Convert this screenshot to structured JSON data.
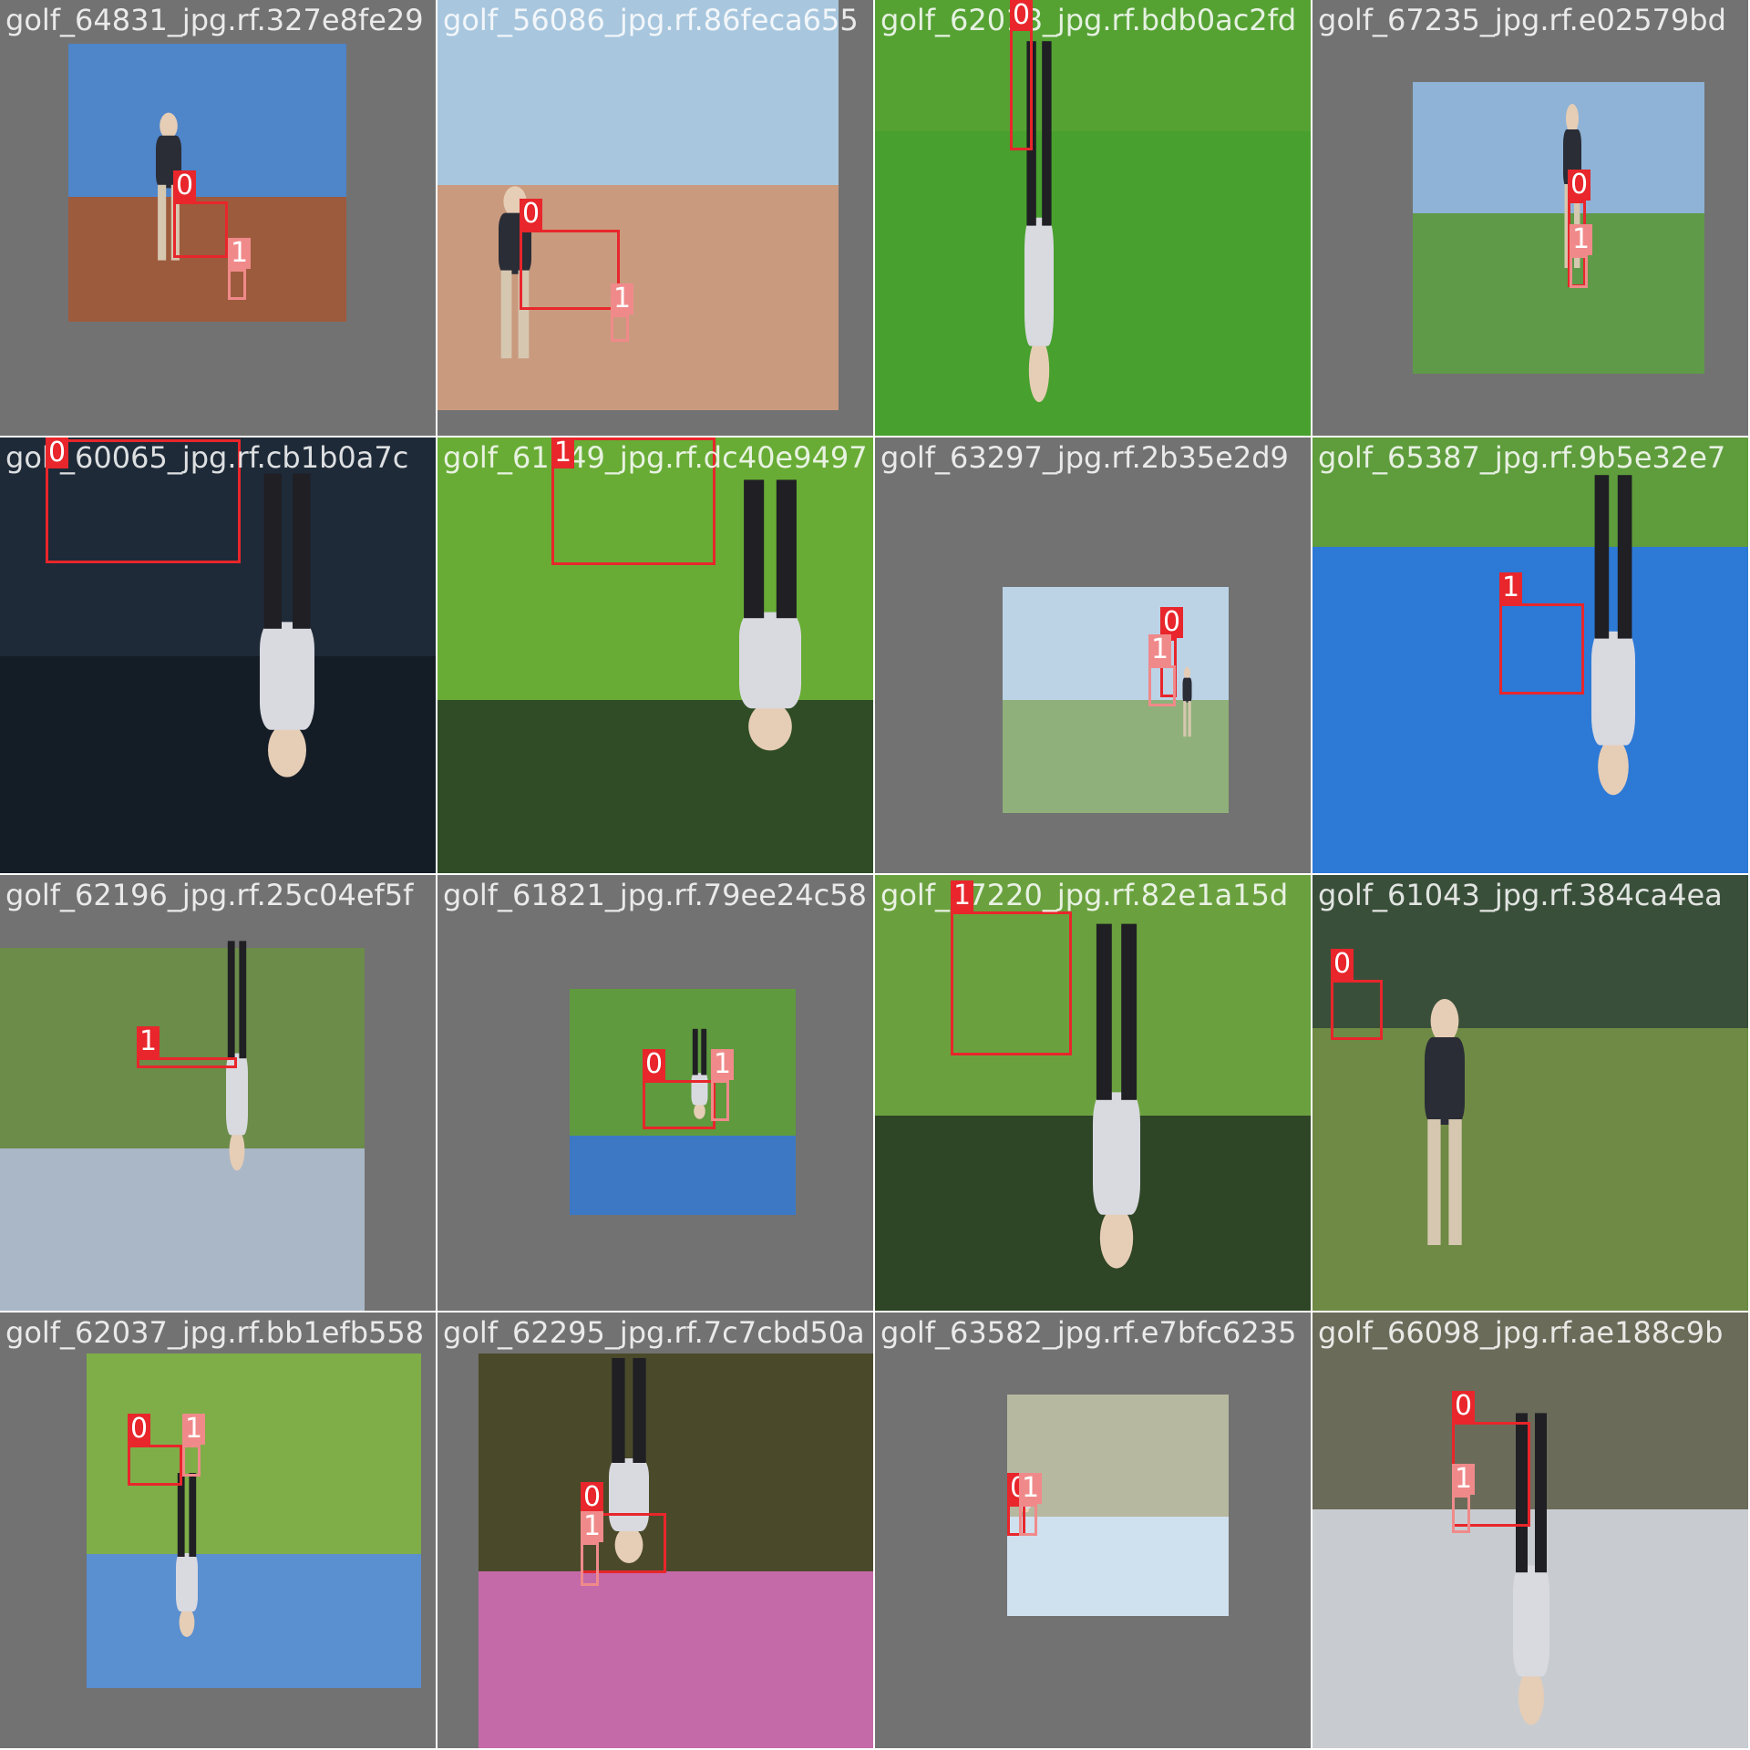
{
  "class_colors": {
    "0": "#e8262b",
    "1": "#f08a8a"
  },
  "tiles": [
    {
      "filename": "golf_64831_jpg.rf.327e8fe29",
      "sky": "#4f85c9",
      "ground": "#9d5b3e",
      "flip": false,
      "boxes": [
        {
          "label": "0",
          "cls": "0"
        },
        {
          "label": "1",
          "cls": "1"
        }
      ]
    },
    {
      "filename": "golf_56086_jpg.rf.86feca655",
      "sky": "#a8c7de",
      "ground": "#c99a7e",
      "flip": false,
      "boxes": [
        {
          "label": "0",
          "cls": "0"
        },
        {
          "label": "1",
          "cls": "1"
        }
      ]
    },
    {
      "filename": "golf_62018_jpg.rf.bdb0ac2fd",
      "sky": "#55a233",
      "ground": "#48a02e",
      "flip": true,
      "boxes": [
        {
          "label": "0",
          "cls": "0"
        }
      ]
    },
    {
      "filename": "golf_67235_jpg.rf.e02579bd",
      "sky": "#8eb3d6",
      "ground": "#5f9a48",
      "flip": false,
      "boxes": [
        {
          "label": "0",
          "cls": "0"
        },
        {
          "label": "1",
          "cls": "1"
        }
      ]
    },
    {
      "filename": "golf_60065_jpg.rf.cb1b0a7c",
      "sky": "#1e2a38",
      "ground": "#141c26",
      "flip": true,
      "boxes": [
        {
          "label": "0",
          "cls": "0"
        }
      ]
    },
    {
      "filename": "golf_61849_jpg.rf.dc40e9497",
      "sky": "#68ac35",
      "ground": "#2f4c26",
      "flip": true,
      "boxes": [
        {
          "label": "1",
          "cls": "0"
        }
      ]
    },
    {
      "filename": "golf_63297_jpg.rf.2b35e2d9",
      "sky": "#bcd3e6",
      "ground": "#8fb07a",
      "flip": false,
      "boxes": [
        {
          "label": "0",
          "cls": "0"
        },
        {
          "label": "1",
          "cls": "1"
        }
      ]
    },
    {
      "filename": "golf_65387_jpg.rf.9b5e32e7",
      "sky": "#5e9c3c",
      "ground": "#2d79d6",
      "flip": true,
      "boxes": [
        {
          "label": "1",
          "cls": "0"
        }
      ]
    },
    {
      "filename": "golf_62196_jpg.rf.25c04ef5f",
      "sky": "#6c8c4a",
      "ground": "#aab7c7",
      "flip": true,
      "boxes": [
        {
          "label": "1",
          "cls": "0"
        }
      ]
    },
    {
      "filename": "golf_61821_jpg.rf.79ee24c58",
      "sky": "#5f9a3e",
      "ground": "#3c78c4",
      "flip": true,
      "boxes": [
        {
          "label": "0",
          "cls": "0"
        },
        {
          "label": "1",
          "cls": "1"
        }
      ]
    },
    {
      "filename": "golf_67220_jpg.rf.82e1a15d",
      "sky": "#6aa13e",
      "ground": "#2e4526",
      "flip": true,
      "boxes": [
        {
          "label": "1",
          "cls": "0"
        }
      ]
    },
    {
      "filename": "golf_61043_jpg.rf.384ca4ea",
      "sky": "#3a4f3a",
      "ground": "#6e8a44",
      "flip": false,
      "boxes": [
        {
          "label": "0",
          "cls": "0"
        }
      ]
    },
    {
      "filename": "golf_62037_jpg.rf.bb1efb558",
      "sky": "#7fae48",
      "ground": "#5a8fd0",
      "flip": true,
      "boxes": [
        {
          "label": "0",
          "cls": "0"
        },
        {
          "label": "1",
          "cls": "1"
        }
      ]
    },
    {
      "filename": "golf_62295_jpg.rf.7c7cbd50a",
      "sky": "#4a4a2a",
      "ground": "#c46aa8",
      "flip": true,
      "boxes": [
        {
          "label": "0",
          "cls": "0"
        },
        {
          "label": "1",
          "cls": "1"
        }
      ]
    },
    {
      "filename": "golf_63582_jpg.rf.e7bfc6235",
      "sky": "#b7b8a0",
      "ground": "#cfe0ef",
      "flip": true,
      "boxes": [
        {
          "label": "0",
          "cls": "0"
        },
        {
          "label": "1",
          "cls": "1"
        }
      ]
    },
    {
      "filename": "golf_66098_jpg.rf.ae188c9b",
      "sky": "#6b6b5a",
      "ground": "#c8ccd0",
      "flip": true,
      "boxes": [
        {
          "label": "0",
          "cls": "0"
        },
        {
          "label": "1",
          "cls": "1"
        }
      ]
    }
  ]
}
